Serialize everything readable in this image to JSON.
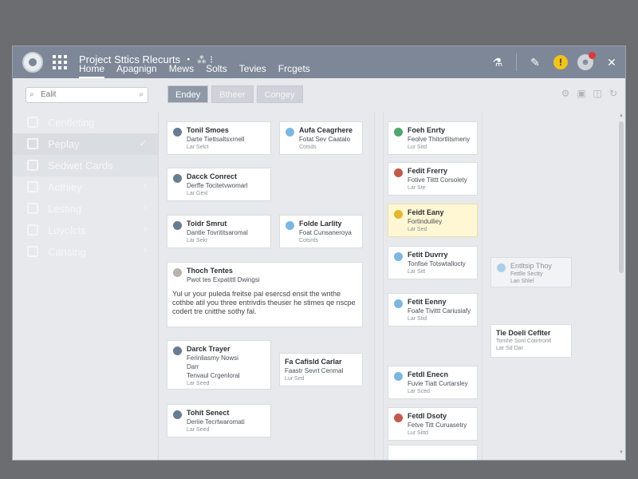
{
  "header": {
    "title": "Project Sttics Rlecurts ・ ⁂ ⁝",
    "nav": [
      "Home",
      "Apagnign",
      "Mews",
      "Solts",
      "Tevies",
      "Frcgets"
    ]
  },
  "toolbar": {
    "search_placeholder": "Ealit",
    "view_buttons": [
      "Endey",
      "Btheer",
      "Congey"
    ]
  },
  "sidebar": {
    "items": [
      {
        "label": "Centleting"
      },
      {
        "label": "Peplay"
      },
      {
        "label": "Sedwet Cards"
      },
      {
        "label": "Acthiey"
      },
      {
        "label": "Lesting"
      },
      {
        "label": "Loyolcts"
      },
      {
        "label": "Cansing"
      }
    ]
  },
  "cards": {
    "c1": {
      "title": "Tonil Smoes",
      "sub": "Darte Tiettsaltsxrnell",
      "meta": "Lar Selct"
    },
    "c2": {
      "title": "Aufa Ceagrhere",
      "sub": "Fotat Sev Caatalo",
      "meta": "Cotsds"
    },
    "c3": {
      "title": "Dacck Conrect",
      "sub": "Derffe Tocitetvwomarl",
      "meta": "Lar Gexl"
    },
    "c4": {
      "title": "Toidr Smrut",
      "sub": "Dantle Tovrititsaromal",
      "meta": "Lar Sekr"
    },
    "c5": {
      "title": "Folde Larlity",
      "sub": "Foat Cunsaneroya",
      "meta": "Cotsrds"
    },
    "c6": {
      "title": "Thoch Tentes",
      "sub": "Pwot tes Expatittl Dwingsi",
      "body": "Yul ur your puleda freitse pal esercsd ensit the wnthe cothbe atil you three entrivdis theuser he stimes qe nscpe codert tre cnitthe sothy fal."
    },
    "c7": {
      "title": "Darck Trayer",
      "sub": "Ferinliasmy Nowsi",
      "sub2": "Darr",
      "sub3": "Tenvaul Crgenloral",
      "meta": "Lar Seed"
    },
    "c8": {
      "title": "Fa Cafisld Carlar",
      "sub": "Faastr Sevrt Cenmal",
      "meta": "Lur Sed"
    },
    "c9": {
      "title": "Tohit Senect",
      "sub": "Deriie Tecrtwaromati",
      "meta": "Lar Seed"
    },
    "d1": {
      "title": "Foeh Enrty",
      "sub": "Feolve Thitortlitsmeny",
      "meta": "Lur Sitd"
    },
    "d2": {
      "title": "Fedit Frerry",
      "sub": "Fotive Tiittt Corsolety",
      "meta": "Lar Ste"
    },
    "d3": {
      "title": "Feidt Eany",
      "sub": "Fortinduiliey",
      "meta": "Lar Sed"
    },
    "d4": {
      "title": "Fetit Duvrry",
      "sub": "Tonfise Totswtallocty",
      "meta": "Lar Sitt"
    },
    "d5": {
      "title": "Fetit Eenny",
      "sub": "Foafe Tivittt Cariusiafy",
      "meta": "Lar Stid"
    },
    "d6": {
      "title": "Fetdl Enecn",
      "sub": "Fuvie Tiatt Curtarsley",
      "meta": "Lar Sced"
    },
    "d7": {
      "title": "Fetdl Dsoty",
      "sub": "Fetve Titt Curuasetry",
      "meta": "Lur Sittd"
    },
    "e1": {
      "title": "Entltsip Thoy",
      "sub": "Fettlle Sectty",
      "meta": "Lan Shlel"
    },
    "e2": {
      "title": "Tie Doeli Ceflter",
      "sub": "Tomhe Sonl Cotirtrontl",
      "meta": "Lar Sd Dar"
    }
  }
}
